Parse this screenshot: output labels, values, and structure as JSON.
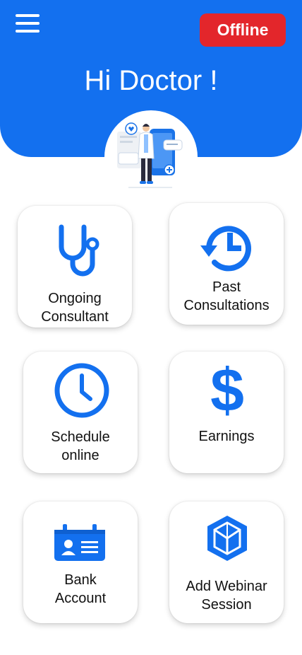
{
  "header": {
    "greeting": "Hi Doctor !",
    "status_label": "Offline",
    "accent_color": "#1370ef",
    "status_color": "#e3262b"
  },
  "menu": {
    "icon": "hamburger-menu-icon"
  },
  "avatar": {
    "icon": "doctor-illustration"
  },
  "cards": [
    {
      "label": "Ongoing\nConsultant",
      "icon": "stethoscope-icon"
    },
    {
      "label": "Past\nConsultations",
      "icon": "history-icon"
    },
    {
      "label": "Schedule\nonline",
      "icon": "clock-icon"
    },
    {
      "label": "Earnings",
      "icon": "dollar-icon"
    },
    {
      "label": "Bank\nAccount",
      "icon": "id-card-icon"
    },
    {
      "label": "Add Webinar\nSession",
      "icon": "cube-icon"
    }
  ]
}
